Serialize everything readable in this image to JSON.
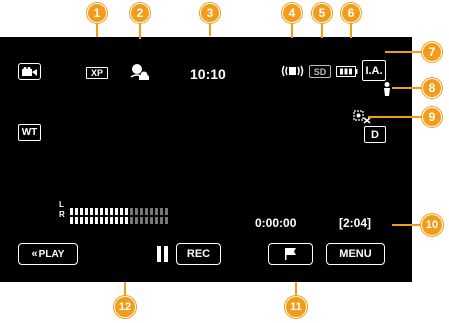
{
  "callouts": [
    "1",
    "2",
    "3",
    "4",
    "5",
    "6",
    "7",
    "8",
    "9",
    "10",
    "11",
    "12"
  ],
  "top_bar": {
    "quality": "XP",
    "time": "10:10",
    "card": "SD",
    "mode": "I.A."
  },
  "left": {
    "zoom": "WT"
  },
  "right": {
    "d_label": "D"
  },
  "audio": {
    "left_label": "L",
    "right_label": "R",
    "left_level": 0.6,
    "right_level": 0.6
  },
  "counters": {
    "elapsed": "0:00:00",
    "remaining": "[2:04]"
  },
  "buttons": {
    "play": "PLAY",
    "rec": "REC",
    "menu": "MENU"
  },
  "colors": {
    "callout": "#f39c1a",
    "screen": "#000000"
  },
  "icons": [
    "camera-mode-icon",
    "face-recognition-icon",
    "image-stabilizer-icon",
    "battery-icon",
    "scene-icon",
    "touch-priority-off-icon",
    "pause-icon",
    "flag-icon"
  ]
}
